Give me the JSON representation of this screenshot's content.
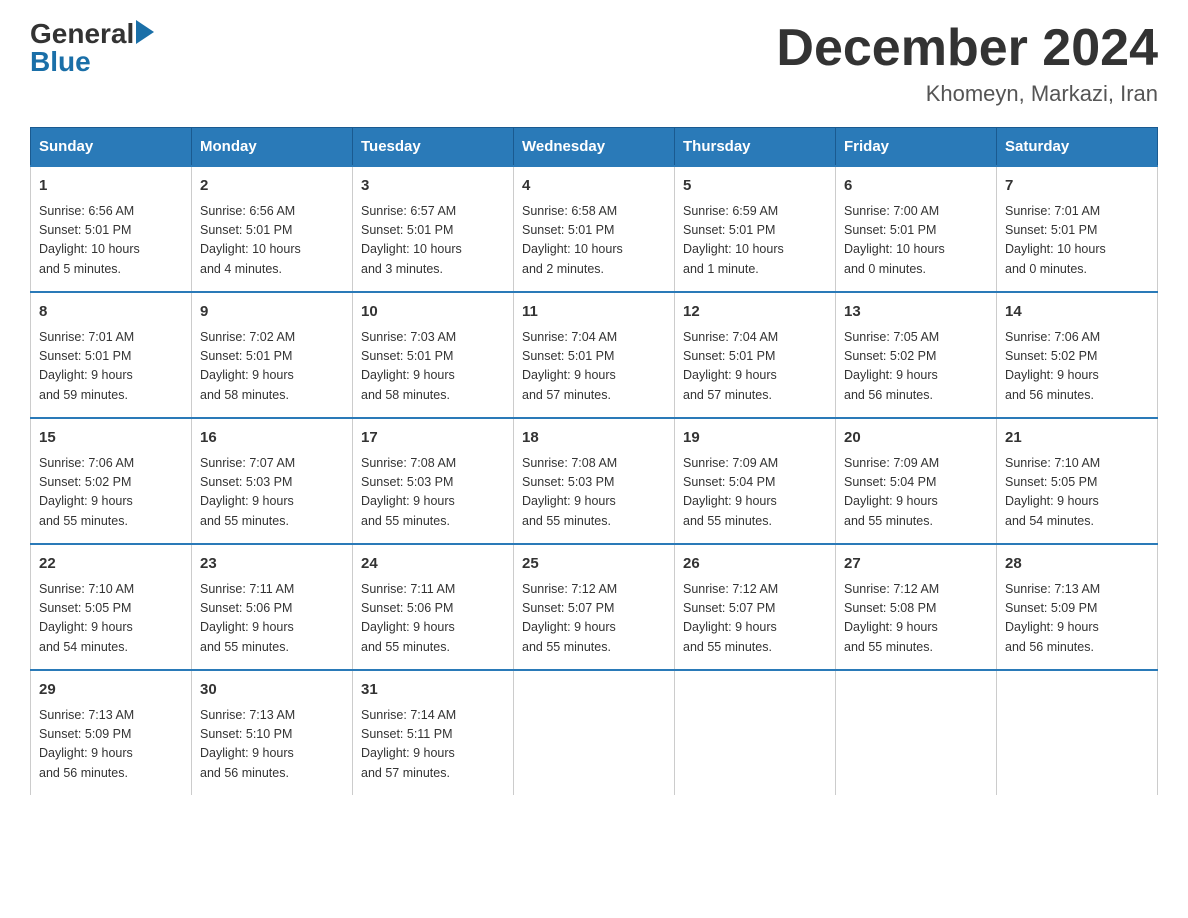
{
  "header": {
    "logo_general": "General",
    "logo_blue": "Blue",
    "month_title": "December 2024",
    "location": "Khomeyn, Markazi, Iran"
  },
  "days_of_week": [
    "Sunday",
    "Monday",
    "Tuesday",
    "Wednesday",
    "Thursday",
    "Friday",
    "Saturday"
  ],
  "weeks": [
    [
      {
        "day": "1",
        "info": "Sunrise: 6:56 AM\nSunset: 5:01 PM\nDaylight: 10 hours\nand 5 minutes."
      },
      {
        "day": "2",
        "info": "Sunrise: 6:56 AM\nSunset: 5:01 PM\nDaylight: 10 hours\nand 4 minutes."
      },
      {
        "day": "3",
        "info": "Sunrise: 6:57 AM\nSunset: 5:01 PM\nDaylight: 10 hours\nand 3 minutes."
      },
      {
        "day": "4",
        "info": "Sunrise: 6:58 AM\nSunset: 5:01 PM\nDaylight: 10 hours\nand 2 minutes."
      },
      {
        "day": "5",
        "info": "Sunrise: 6:59 AM\nSunset: 5:01 PM\nDaylight: 10 hours\nand 1 minute."
      },
      {
        "day": "6",
        "info": "Sunrise: 7:00 AM\nSunset: 5:01 PM\nDaylight: 10 hours\nand 0 minutes."
      },
      {
        "day": "7",
        "info": "Sunrise: 7:01 AM\nSunset: 5:01 PM\nDaylight: 10 hours\nand 0 minutes."
      }
    ],
    [
      {
        "day": "8",
        "info": "Sunrise: 7:01 AM\nSunset: 5:01 PM\nDaylight: 9 hours\nand 59 minutes."
      },
      {
        "day": "9",
        "info": "Sunrise: 7:02 AM\nSunset: 5:01 PM\nDaylight: 9 hours\nand 58 minutes."
      },
      {
        "day": "10",
        "info": "Sunrise: 7:03 AM\nSunset: 5:01 PM\nDaylight: 9 hours\nand 58 minutes."
      },
      {
        "day": "11",
        "info": "Sunrise: 7:04 AM\nSunset: 5:01 PM\nDaylight: 9 hours\nand 57 minutes."
      },
      {
        "day": "12",
        "info": "Sunrise: 7:04 AM\nSunset: 5:01 PM\nDaylight: 9 hours\nand 57 minutes."
      },
      {
        "day": "13",
        "info": "Sunrise: 7:05 AM\nSunset: 5:02 PM\nDaylight: 9 hours\nand 56 minutes."
      },
      {
        "day": "14",
        "info": "Sunrise: 7:06 AM\nSunset: 5:02 PM\nDaylight: 9 hours\nand 56 minutes."
      }
    ],
    [
      {
        "day": "15",
        "info": "Sunrise: 7:06 AM\nSunset: 5:02 PM\nDaylight: 9 hours\nand 55 minutes."
      },
      {
        "day": "16",
        "info": "Sunrise: 7:07 AM\nSunset: 5:03 PM\nDaylight: 9 hours\nand 55 minutes."
      },
      {
        "day": "17",
        "info": "Sunrise: 7:08 AM\nSunset: 5:03 PM\nDaylight: 9 hours\nand 55 minutes."
      },
      {
        "day": "18",
        "info": "Sunrise: 7:08 AM\nSunset: 5:03 PM\nDaylight: 9 hours\nand 55 minutes."
      },
      {
        "day": "19",
        "info": "Sunrise: 7:09 AM\nSunset: 5:04 PM\nDaylight: 9 hours\nand 55 minutes."
      },
      {
        "day": "20",
        "info": "Sunrise: 7:09 AM\nSunset: 5:04 PM\nDaylight: 9 hours\nand 55 minutes."
      },
      {
        "day": "21",
        "info": "Sunrise: 7:10 AM\nSunset: 5:05 PM\nDaylight: 9 hours\nand 54 minutes."
      }
    ],
    [
      {
        "day": "22",
        "info": "Sunrise: 7:10 AM\nSunset: 5:05 PM\nDaylight: 9 hours\nand 54 minutes."
      },
      {
        "day": "23",
        "info": "Sunrise: 7:11 AM\nSunset: 5:06 PM\nDaylight: 9 hours\nand 55 minutes."
      },
      {
        "day": "24",
        "info": "Sunrise: 7:11 AM\nSunset: 5:06 PM\nDaylight: 9 hours\nand 55 minutes."
      },
      {
        "day": "25",
        "info": "Sunrise: 7:12 AM\nSunset: 5:07 PM\nDaylight: 9 hours\nand 55 minutes."
      },
      {
        "day": "26",
        "info": "Sunrise: 7:12 AM\nSunset: 5:07 PM\nDaylight: 9 hours\nand 55 minutes."
      },
      {
        "day": "27",
        "info": "Sunrise: 7:12 AM\nSunset: 5:08 PM\nDaylight: 9 hours\nand 55 minutes."
      },
      {
        "day": "28",
        "info": "Sunrise: 7:13 AM\nSunset: 5:09 PM\nDaylight: 9 hours\nand 56 minutes."
      }
    ],
    [
      {
        "day": "29",
        "info": "Sunrise: 7:13 AM\nSunset: 5:09 PM\nDaylight: 9 hours\nand 56 minutes."
      },
      {
        "day": "30",
        "info": "Sunrise: 7:13 AM\nSunset: 5:10 PM\nDaylight: 9 hours\nand 56 minutes."
      },
      {
        "day": "31",
        "info": "Sunrise: 7:14 AM\nSunset: 5:11 PM\nDaylight: 9 hours\nand 57 minutes."
      },
      {
        "day": "",
        "info": ""
      },
      {
        "day": "",
        "info": ""
      },
      {
        "day": "",
        "info": ""
      },
      {
        "day": "",
        "info": ""
      }
    ]
  ]
}
